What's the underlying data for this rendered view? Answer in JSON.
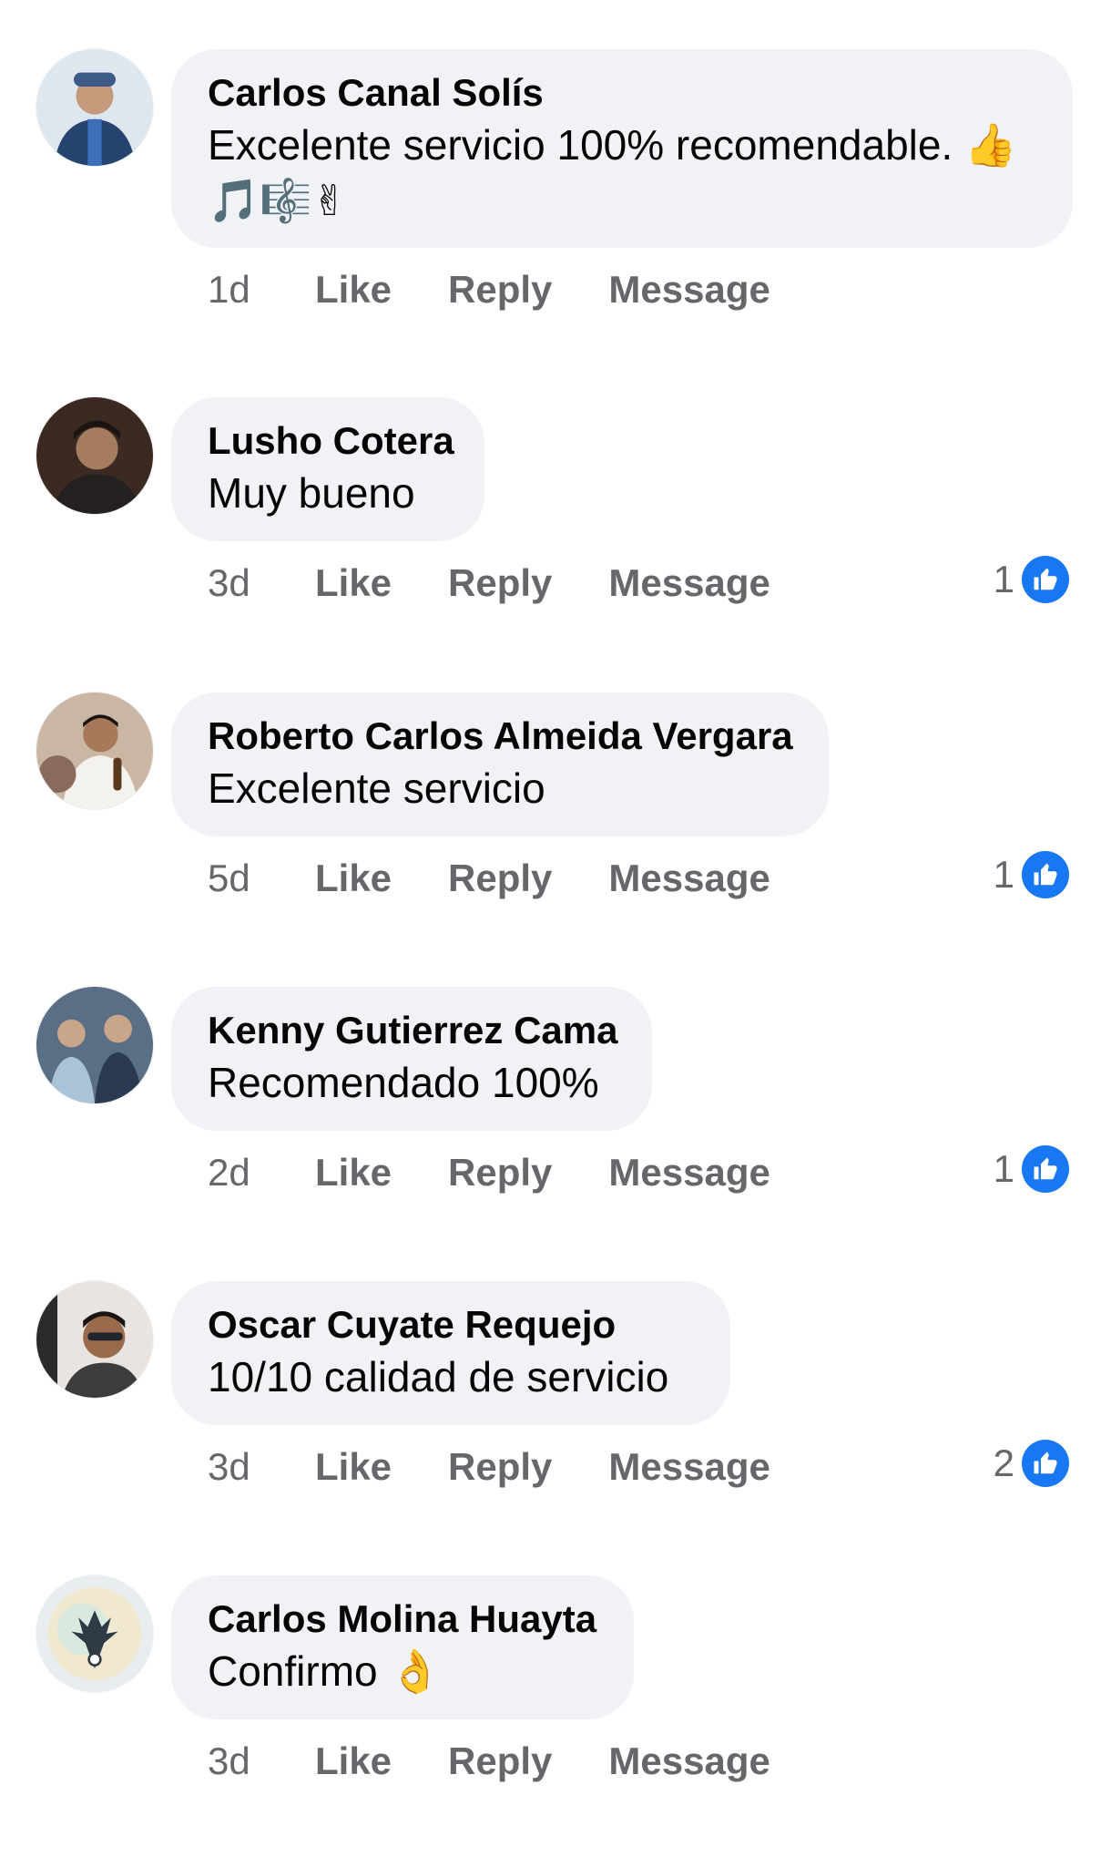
{
  "comments": [
    {
      "author": "Carlos Canal Solís",
      "text": "Excelente servicio 100% recomendable. 👍",
      "emoji_line": "🎵🎼✌",
      "time": "1d",
      "like": "Like",
      "reply": "Reply",
      "message": "Message",
      "reactions": ""
    },
    {
      "author": "Lusho Cotera",
      "text": "Muy bueno",
      "time": "3d",
      "like": "Like",
      "reply": "Reply",
      "message": "Message",
      "reactions": "1"
    },
    {
      "author": "Roberto Carlos Almeida Vergara",
      "text": "Excelente servicio",
      "time": "5d",
      "like": "Like",
      "reply": "Reply",
      "message": "Message",
      "reactions": "1"
    },
    {
      "author": "Kenny Gutierrez Cama",
      "text": "Recomendado 100%",
      "time": "2d",
      "like": "Like",
      "reply": "Reply",
      "message": "Message",
      "reactions": "1"
    },
    {
      "author": "Oscar Cuyate Requejo",
      "text": "10/10 calidad de servicio",
      "time": "3d",
      "like": "Like",
      "reply": "Reply",
      "message": "Message",
      "reactions": "2"
    },
    {
      "author": "Carlos Molina Huayta",
      "text": "Confirmo 👌",
      "time": "3d",
      "like": "Like",
      "reply": "Reply",
      "message": "Message",
      "reactions": ""
    }
  ],
  "icons": {
    "like_badge": "thumbs-up-icon",
    "like_badge_color": "#1877f2"
  },
  "colors": {
    "bubble": "#f0f2f5",
    "meta_text": "#65676b"
  }
}
